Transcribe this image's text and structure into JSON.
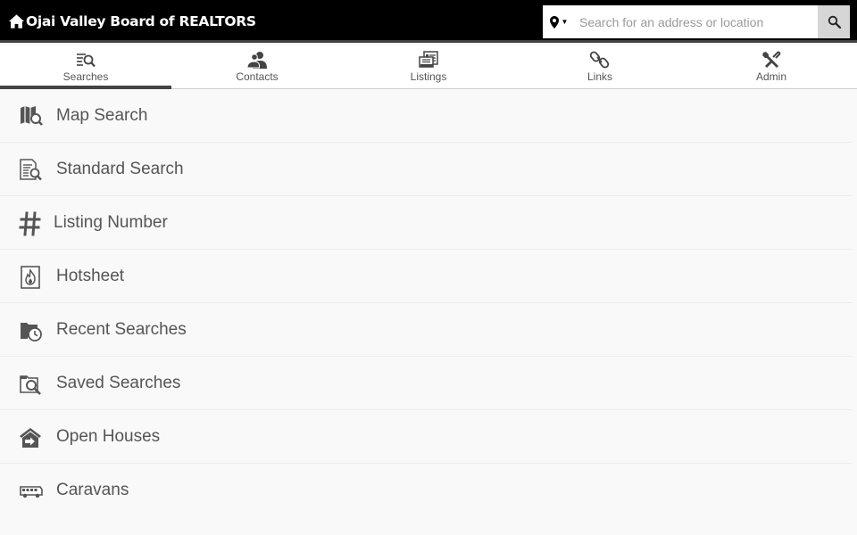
{
  "header": {
    "title": "Ojai Valley Board of REALTORS",
    "home_icon": "home-icon",
    "search": {
      "placeholder": "Search for an address or location",
      "value": "",
      "location_icon": "map-pin-icon",
      "button_icon": "search-icon"
    }
  },
  "tabs": [
    {
      "label": "Searches",
      "icon": "search-list-icon",
      "active": true
    },
    {
      "label": "Contacts",
      "icon": "contacts-icon",
      "active": false
    },
    {
      "label": "Listings",
      "icon": "listings-icon",
      "active": false
    },
    {
      "label": "Links",
      "icon": "link-icon",
      "active": false
    },
    {
      "label": "Admin",
      "icon": "wrench-icon",
      "active": false
    }
  ],
  "menu": [
    {
      "label": "Map Search",
      "icon": "map-search-icon"
    },
    {
      "label": "Standard Search",
      "icon": "document-search-icon"
    },
    {
      "label": "Listing Number",
      "icon": "hash-icon"
    },
    {
      "label": "Hotsheet",
      "icon": "flame-document-icon"
    },
    {
      "label": "Recent Searches",
      "icon": "folder-clock-icon"
    },
    {
      "label": "Saved Searches",
      "icon": "folder-search-icon"
    },
    {
      "label": "Open Houses",
      "icon": "house-arrow-icon"
    },
    {
      "label": "Caravans",
      "icon": "bus-icon"
    }
  ],
  "colors": {
    "topbar": "#000000",
    "active_tab_indicator": "#444444",
    "text": "#555555"
  }
}
